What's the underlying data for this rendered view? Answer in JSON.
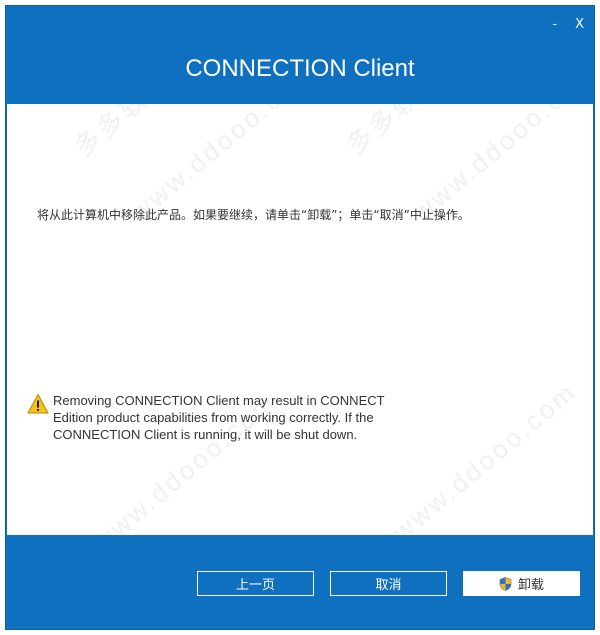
{
  "window": {
    "controls": {
      "minimize": "-",
      "close": "X"
    },
    "title": "CONNECTION Client"
  },
  "content": {
    "instruction": "将从此计算机中移除此产品。如果要继续，请单击“卸载”；单击“取消”中止操作。",
    "warning_text": "Removing CONNECTION Client may result in CONNECT Edition product capabilities from working correctly. If the CONNECTION Client is running, it will be shut down."
  },
  "watermarks": [
    "多多软件站",
    "www.ddooo.com",
    "多多软件站",
    "www.ddooo.com",
    "多多软件站",
    "www.ddooo.com"
  ],
  "footer": {
    "back_label": "上一页",
    "cancel_label": "取消",
    "uninstall_label": "卸载"
  },
  "colors": {
    "brand_blue": "#0f70c0",
    "content_bg": "#ffffff"
  }
}
